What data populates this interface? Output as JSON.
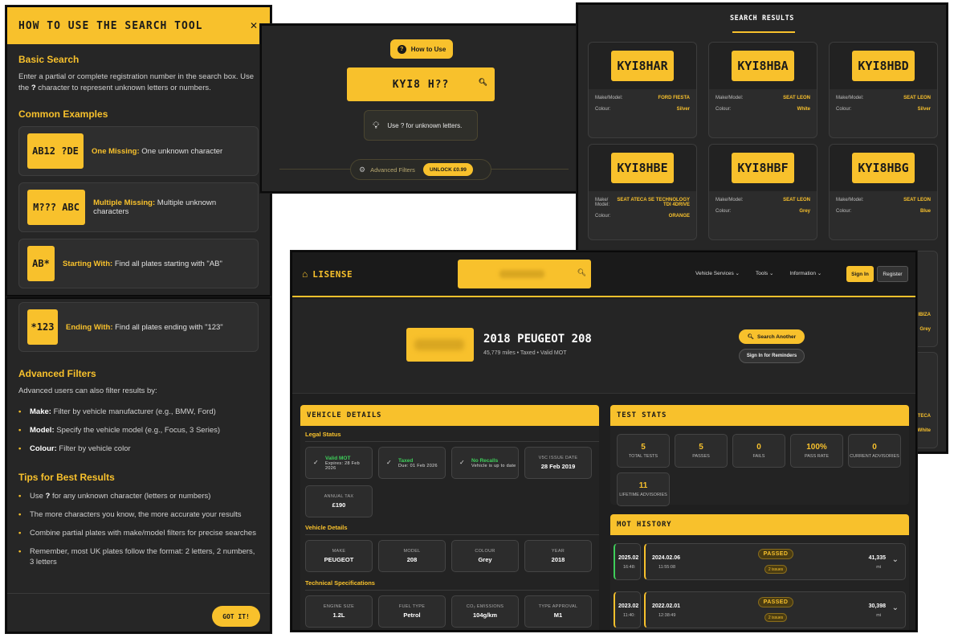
{
  "help": {
    "title": "HOW TO USE THE SEARCH TOOL",
    "close": "✕",
    "basic_title": "Basic Search",
    "basic_text_1": "Enter a partial or complete registration number in the search box. Use the ",
    "basic_text_q": "?",
    "basic_text_2": " character to represent unknown letters or numbers.",
    "examples_title": "Common Examples",
    "examples": [
      {
        "plate": "AB12 ?DE",
        "label": "One Missing:",
        "text": " One unknown character"
      },
      {
        "plate": "M??? ABC",
        "label": "Multiple Missing:",
        "text": " Multiple unknown characters"
      },
      {
        "plate": "AB*",
        "label": "Starting With:",
        "text": " Find all plates starting with \"AB\""
      },
      {
        "plate": "*123",
        "label": "Ending With:",
        "text": " Find all plates ending with \"123\""
      }
    ],
    "advanced_title": "Advanced Filters",
    "advanced_intro": "Advanced users can also filter results by:",
    "filters": [
      {
        "label": "Make:",
        "text": " Filter by vehicle manufacturer (e.g., BMW, Ford)"
      },
      {
        "label": "Model:",
        "text": " Specify the vehicle model (e.g., Focus, 3 Series)"
      },
      {
        "label": "Colour:",
        "text": " Filter by vehicle color"
      }
    ],
    "tips_title": "Tips for Best Results",
    "tips": [
      {
        "pre": "Use ",
        "bold": "?",
        "post": " for any unknown character (letters or numbers)"
      },
      {
        "pre": "The more characters you know, the more accurate your results",
        "bold": "",
        "post": ""
      },
      {
        "pre": "Combine partial plates with make/model filters for precise searches",
        "bold": "",
        "post": ""
      },
      {
        "pre": "Remember, most UK plates follow the format: 2 letters, 2 numbers, 3 letters",
        "bold": "",
        "post": ""
      }
    ],
    "got_it": "GOT IT!"
  },
  "search_widget": {
    "how_to": "How to Use",
    "query": "KYI8 H??",
    "hint": "Use ? for unknown letters.",
    "adv_filters": "Advanced Filters",
    "unlock": "UNLOCK £0.99"
  },
  "results": {
    "title": "SEARCH RESULTS",
    "make_label": "Make/Model:",
    "make_label_split": "Make/ Model:",
    "colour_label": "Colour:",
    "cards": [
      {
        "plate": "KYI8HAR",
        "make": "FORD FIESTA",
        "colour": "Silver"
      },
      {
        "plate": "KYI8HBA",
        "make": "SEAT LEON",
        "colour": "White"
      },
      {
        "plate": "KYI8HBD",
        "make": "SEAT LEON",
        "colour": "Silver"
      },
      {
        "plate": "KYI8HBE",
        "make": "SEAT ATECA SE TECHNOLOGY TDI 4DRIVE",
        "colour": "ORANGE"
      },
      {
        "plate": "KYI8HBF",
        "make": "SEAT LEON",
        "colour": "Grey"
      },
      {
        "plate": "KYI8HBG",
        "make": "SEAT LEON",
        "colour": "Blue"
      }
    ],
    "peek": [
      "IBIZA",
      "Grey",
      "ATECA",
      "White"
    ]
  },
  "app": {
    "brand": "LISENSE",
    "nav": [
      "Vehicle Services",
      "Tools",
      "Information"
    ],
    "sign_in": "Sign In",
    "register": "Register",
    "vehicle_title": "2018 PEUGEOT 208",
    "vehicle_sub": "45,779 miles • Taxed • Valid MOT",
    "search_another": "Search Another",
    "reminders": "Sign In for Reminders",
    "vd_head": "VEHICLE DETAILS",
    "legal_status": "Legal Status",
    "legal": [
      {
        "t": "Valid MOT",
        "s": "Expires: 28 Feb 2026"
      },
      {
        "t": "Taxed",
        "s": "Due: 01 Feb 2026"
      },
      {
        "t": "No Recalls",
        "s": "Vehicle is up to date"
      }
    ],
    "v5c_label": "V5C ISSUE DATE",
    "v5c_value": "28 Feb 2019",
    "tax_label": "ANNUAL TAX",
    "tax_value": "£190",
    "vehicle_details": "Vehicle Details",
    "details": [
      {
        "l": "MAKE",
        "v": "PEUGEOT"
      },
      {
        "l": "MODEL",
        "v": "208"
      },
      {
        "l": "COLOUR",
        "v": "Grey"
      },
      {
        "l": "YEAR",
        "v": "2018"
      }
    ],
    "tech_specs": "Technical Specifications",
    "specs": [
      {
        "l": "ENGINE SIZE",
        "v": "1.2L"
      },
      {
        "l": "FUEL TYPE",
        "v": "Petrol"
      },
      {
        "l": "CO₂ EMISSIONS",
        "v": "104g/km"
      },
      {
        "l": "TYPE APPROVAL",
        "v": "M1"
      }
    ],
    "ts_head": "TEST STATS",
    "stats": [
      {
        "n": "5",
        "l": "TOTAL TESTS"
      },
      {
        "n": "5",
        "l": "PASSES"
      },
      {
        "n": "0",
        "l": "FAILS"
      },
      {
        "n": "100%",
        "l": "PASS RATE"
      },
      {
        "n": "0",
        "l": "CURRENT ADVISORIES"
      },
      {
        "n": "11",
        "l": "LIFETIME ADVISORIES"
      }
    ],
    "mot_head": "MOT HISTORY",
    "mot": [
      {
        "peek_date": "2025.02",
        "peek_time": "16:48:",
        "date": "2024.02.06",
        "time": "11:55:08",
        "result": "PASSED",
        "issues": "2 issues",
        "miles": "41,335",
        "unit": "mi"
      },
      {
        "peek_date": "2023.02",
        "peek_time": "11:40:",
        "date": "2022.02.01",
        "time": "12:38:49",
        "result": "PASSED",
        "issues": "2 issues",
        "miles": "30,398",
        "unit": "mi"
      }
    ],
    "colors": {
      "accent": "#f8c12c",
      "green": "#3ecf5a",
      "bg": "#1f1f1f"
    }
  }
}
